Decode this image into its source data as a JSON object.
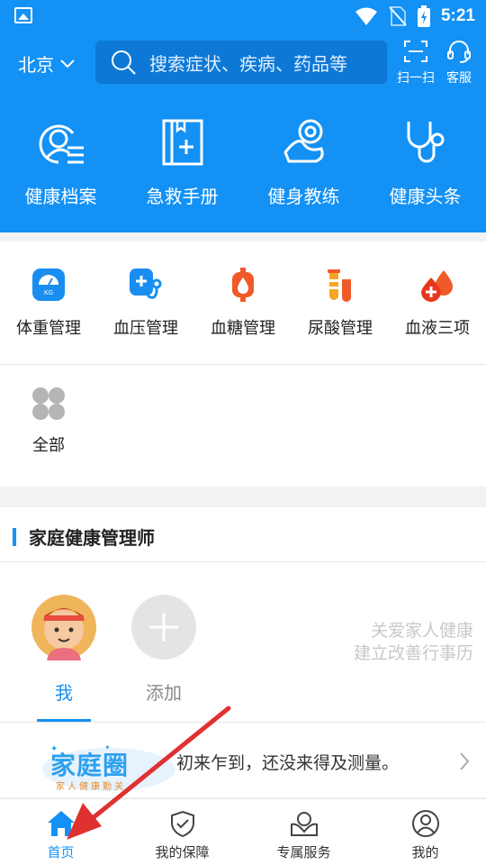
{
  "status_bar": {
    "time": "5:21",
    "icons": [
      "image-icon",
      "wifi-icon",
      "no-sim-icon",
      "battery-icon"
    ]
  },
  "header": {
    "city": "北京",
    "search_placeholder": "搜索症状、疾病、药品等",
    "scan_label": "扫一扫",
    "service_label": "客服"
  },
  "quick_actions": [
    {
      "label": "健康档案",
      "icon": "health-record-icon"
    },
    {
      "label": "急救手册",
      "icon": "first-aid-book-icon"
    },
    {
      "label": "健身教练",
      "icon": "fitness-coach-icon"
    },
    {
      "label": "健康头条",
      "icon": "stethoscope-icon"
    }
  ],
  "health_tools": [
    {
      "label": "体重管理",
      "icon": "scale-icon"
    },
    {
      "label": "血压管理",
      "icon": "blood-pressure-icon"
    },
    {
      "label": "血糖管理",
      "icon": "blood-sugar-icon"
    },
    {
      "label": "尿酸管理",
      "icon": "uric-acid-icon"
    },
    {
      "label": "血液三项",
      "icon": "blood-drops-icon"
    }
  ],
  "all_label": "全部",
  "family_section": {
    "title": "家庭健康管理师",
    "members": [
      {
        "label": "我"
      },
      {
        "label": "添加"
      }
    ],
    "slogan_line1": "关爱家人健康",
    "slogan_line2": "建立改善行事历"
  },
  "family_circle": {
    "logo_title": "家庭圈",
    "logo_subtitle": "家人健康勤关",
    "message": "初来乍到，还没来得及测量。"
  },
  "tabs": [
    {
      "label": "首页",
      "active": true
    },
    {
      "label": "我的保障",
      "active": false
    },
    {
      "label": "专属服务",
      "active": false
    },
    {
      "label": "我的",
      "active": false
    }
  ],
  "colors": {
    "brand_blue": "#1391f5",
    "annotation_arrow": "#e03131"
  }
}
